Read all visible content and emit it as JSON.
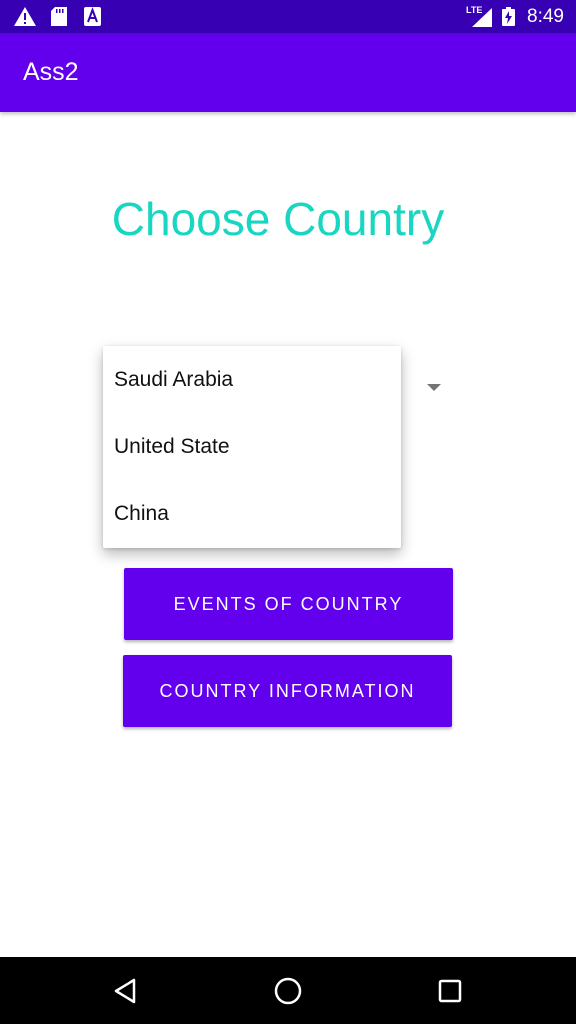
{
  "status_bar": {
    "time": "8:49",
    "network_label": "LTE",
    "icons": [
      "warning-icon",
      "sd-card-icon",
      "font-a-icon",
      "signal-icon",
      "battery-charging-icon"
    ]
  },
  "app_bar": {
    "title": "Ass2"
  },
  "main": {
    "page_title": "Choose Country",
    "spinner": {
      "options": [
        "Saudi Arabia",
        "United State",
        "China"
      ]
    },
    "buttons": {
      "events_label": "EVENTS OF COUNTRY",
      "info_label": "COUNTRY INFORMATION"
    }
  },
  "nav_bar": {
    "icons": [
      "back-icon",
      "home-icon",
      "recents-icon"
    ]
  },
  "colors": {
    "status_bar": "#3700B3",
    "primary": "#6200EE",
    "title_accent": "#19D6C3",
    "nav_bar": "#000000"
  }
}
